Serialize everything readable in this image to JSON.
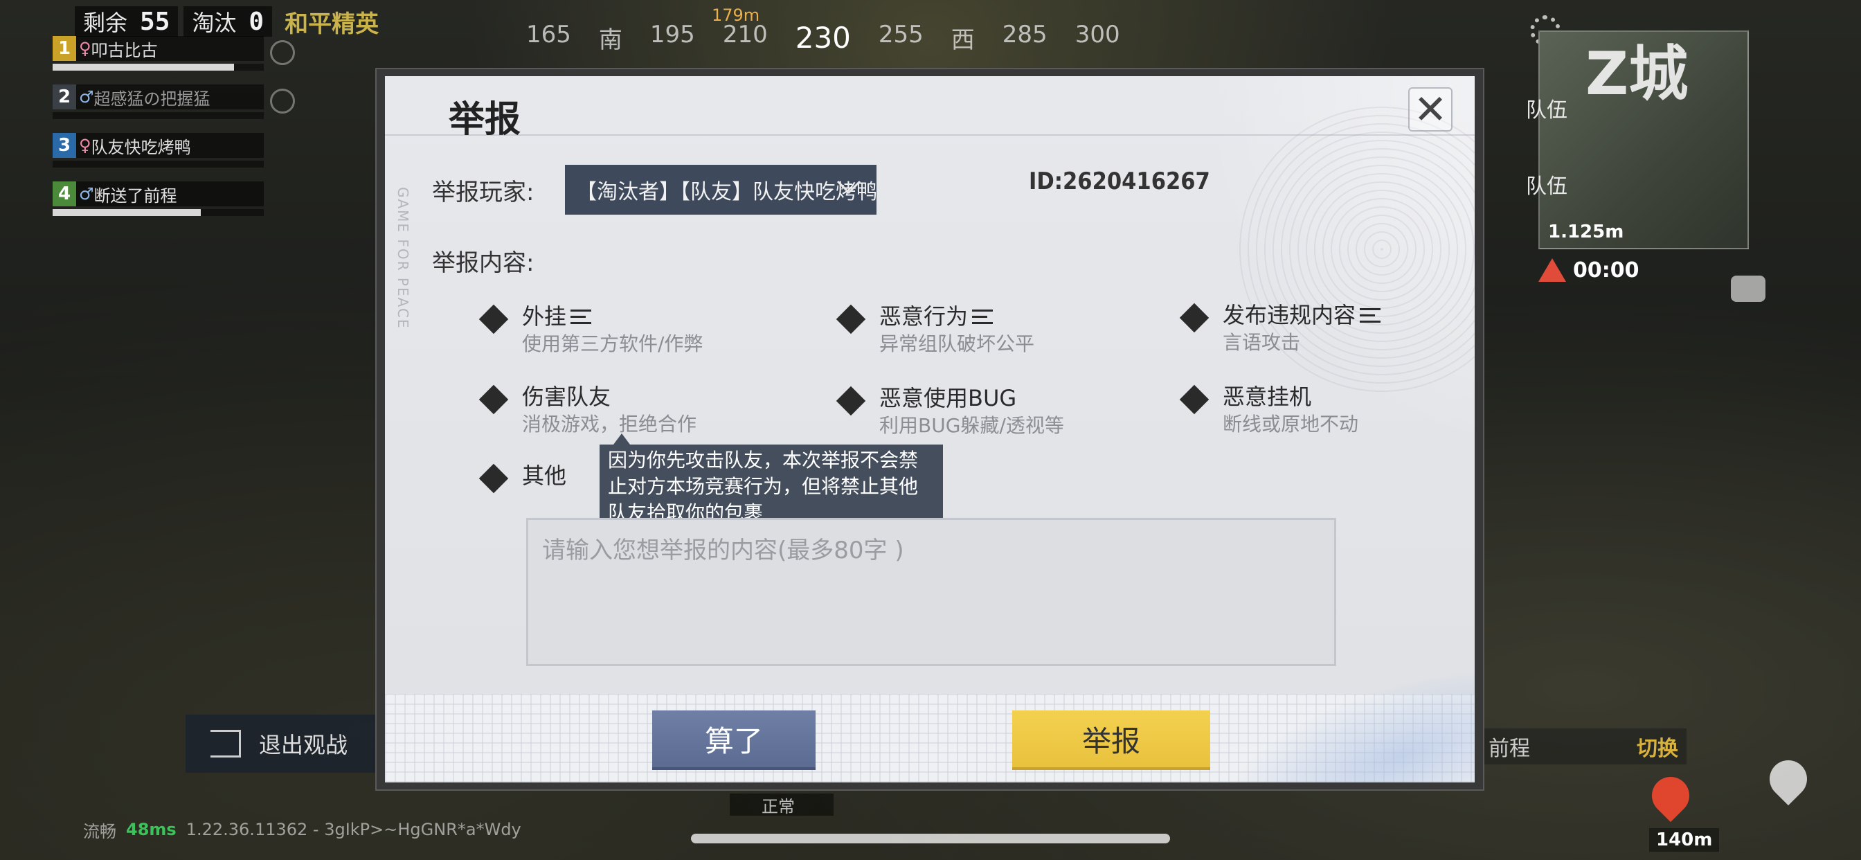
{
  "hud": {
    "remaining_label": "剩余",
    "remaining_count": "55",
    "eliminated_label": "淘汰",
    "eliminated_count": "0",
    "mode_label": "和平精英"
  },
  "team": [
    {
      "num": "1",
      "gender": "♀",
      "name": "叩古比古",
      "color": "#c9a227",
      "hp": 0.86
    },
    {
      "num": "2",
      "gender": "♂",
      "name": "超感猛の把握猛",
      "color": "#3b3f46",
      "hp": 0.0
    },
    {
      "num": "3",
      "gender": "♀",
      "name": "队友快吃烤鸭",
      "color": "#2b6aa8",
      "hp": 0.0
    },
    {
      "num": "4",
      "gender": "♂",
      "name": "断送了前程",
      "color": "#4a8a3a",
      "hp": 0.7
    }
  ],
  "compass": {
    "distance": "179m",
    "ticks": [
      "165",
      "南",
      "195",
      "210",
      "230",
      "255",
      "西",
      "285",
      "300"
    ]
  },
  "minimap": {
    "title": "Z城",
    "labels": [
      "队伍",
      "队伍"
    ],
    "distance": "1.125m",
    "timer": "00:00"
  },
  "bottom_hud": {
    "exit_spectate": "退出观战",
    "switch_name": "前程",
    "switch_label": "切换",
    "status_text": "流畅",
    "ping": "48ms",
    "version": "1.22.36.11362 - 3gIkP>~HgGNR*a*Wdy",
    "normal_badge": "正常",
    "marker_distance": "140m"
  },
  "dialog": {
    "title": "举报",
    "side_brand": "GAME FOR PEACE",
    "close_label": "✕",
    "player_label": "举报玩家:",
    "player_select": "【淘汰者】【队友】队友快吃烤鸭",
    "player_id": "ID:2620416267",
    "content_label": "举报内容:",
    "options": [
      {
        "title": "外挂",
        "sub": "使用第三方软件/作弊",
        "has_menu": true
      },
      {
        "title": "恶意行为",
        "sub": "异常组队破坏公平",
        "has_menu": true
      },
      {
        "title": "发布违规内容",
        "sub": "言语攻击",
        "has_menu": true
      },
      {
        "title": "伤害队友",
        "sub": "消极游戏，拒绝合作",
        "has_menu": false
      },
      {
        "title": "恶意使用BUG",
        "sub": "利用BUG躲藏/透视等",
        "has_menu": false
      },
      {
        "title": "恶意挂机",
        "sub": "断线或原地不动",
        "has_menu": false
      },
      {
        "title": "其他",
        "sub": "",
        "has_menu": false
      }
    ],
    "tooltip": "因为你先攻击队友，本次举报不会禁止对方本场竞赛行为，但将禁止其他队友拾取你的包裹",
    "textarea_placeholder": "请输入您想举报的内容(最多80字 )",
    "cancel_label": "算了",
    "report_label": "举报"
  },
  "colors": {
    "report_button": "#f0cb48",
    "cancel_button": "#6576a0",
    "select_bg": "#3e4a5c"
  }
}
